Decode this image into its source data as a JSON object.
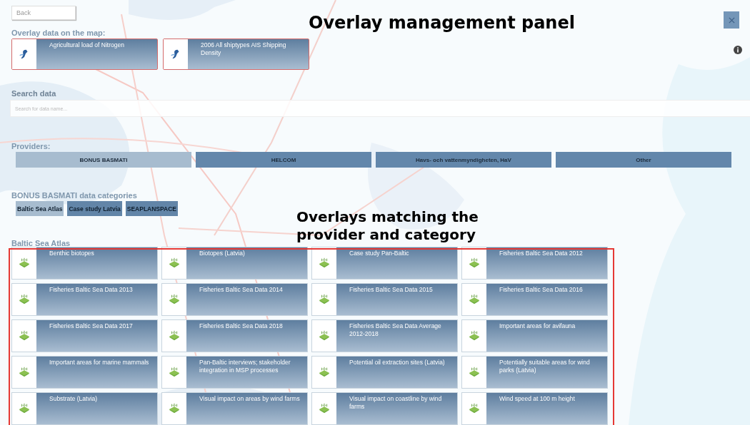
{
  "back_button": {
    "label": "Back"
  },
  "annotations": [
    {
      "kind": "title",
      "text": "Overlay management panel"
    },
    {
      "kind": "callout",
      "text": "Overlays matching the provider and category"
    }
  ],
  "overlay_section": {
    "heading": "Overlay data on the map:",
    "items": [
      {
        "label": "Agricultural load of Nitrogen"
      },
      {
        "label": "2006 All shiptypes AIS Shipping Density"
      }
    ]
  },
  "search": {
    "heading": "Search data",
    "placeholder": "Search for data name..."
  },
  "providers": {
    "heading": "Providers:",
    "items": [
      {
        "label": "BONUS BASMATI",
        "selected": true
      },
      {
        "label": "HELCOM",
        "selected": false
      },
      {
        "label": "Havs- och vattenmyndigheten, HaV",
        "selected": false
      },
      {
        "label": "Other",
        "selected": false
      }
    ]
  },
  "categories": {
    "heading": "BONUS BASMATI data categories",
    "items": [
      {
        "label": "Baltic Sea Atlas",
        "selected": true
      },
      {
        "label": "Case study Latvia",
        "selected": false
      },
      {
        "label": "SEAPLANSPACE",
        "selected": false
      }
    ]
  },
  "datasets": {
    "heading": "Baltic Sea Atlas",
    "items": [
      {
        "label": "Benthic biotopes"
      },
      {
        "label": "Biotopes (Latvia)"
      },
      {
        "label": "Case study Pan-Baltic"
      },
      {
        "label": "Fisheries Baltic Sea Data 2012"
      },
      {
        "label": "Fisheries Baltic Sea Data 2013"
      },
      {
        "label": "Fisheries Baltic Sea Data 2014"
      },
      {
        "label": "Fisheries Baltic Sea Data 2015"
      },
      {
        "label": "Fisheries Baltic Sea Data 2016"
      },
      {
        "label": "Fisheries Baltic Sea Data 2017"
      },
      {
        "label": "Fisheries Baltic Sea Data 2018"
      },
      {
        "label": "Fisheries Baltic Sea Data Average 2012-2018"
      },
      {
        "label": "Important areas for avifauna"
      },
      {
        "label": "Important areas for marine mammals"
      },
      {
        "label": "Pan-Baltic interviews; stakeholder integration in MSP processes"
      },
      {
        "label": "Potential oil extraction sites (Latvia)"
      },
      {
        "label": "Potentially suitable areas for wind parks (Latvia)"
      },
      {
        "label": "Substrate (Latvia)"
      },
      {
        "label": "Visual impact on areas by wind farms"
      },
      {
        "label": "Visual impact on coastline by wind farms"
      },
      {
        "label": "Wind speed at 100 m height"
      }
    ]
  }
}
